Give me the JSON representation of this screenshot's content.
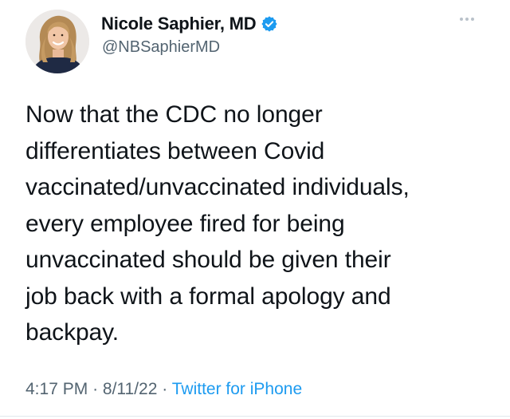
{
  "author": {
    "display_name": "Nicole Saphier, MD",
    "handle": "@NBSaphierMD",
    "verified": true,
    "verified_icon": "verified-badge-icon",
    "avatar_icon": "profile-photo"
  },
  "tweet": {
    "lines": [
      "Now that the CDC no longer",
      "differentiates between Covid",
      "vaccinated/unvaccinated individuals,",
      "every employee fired for being",
      "unvaccinated should be given their",
      "job back with a formal apology and",
      "backpay."
    ]
  },
  "meta": {
    "time": "4:17 PM",
    "separator": "·",
    "date": "8/11/22",
    "source": "Twitter for iPhone"
  },
  "colors": {
    "text": "#0f1419",
    "secondary": "#536471",
    "link": "#1d9bf0",
    "verified": "#1d9bf0"
  }
}
